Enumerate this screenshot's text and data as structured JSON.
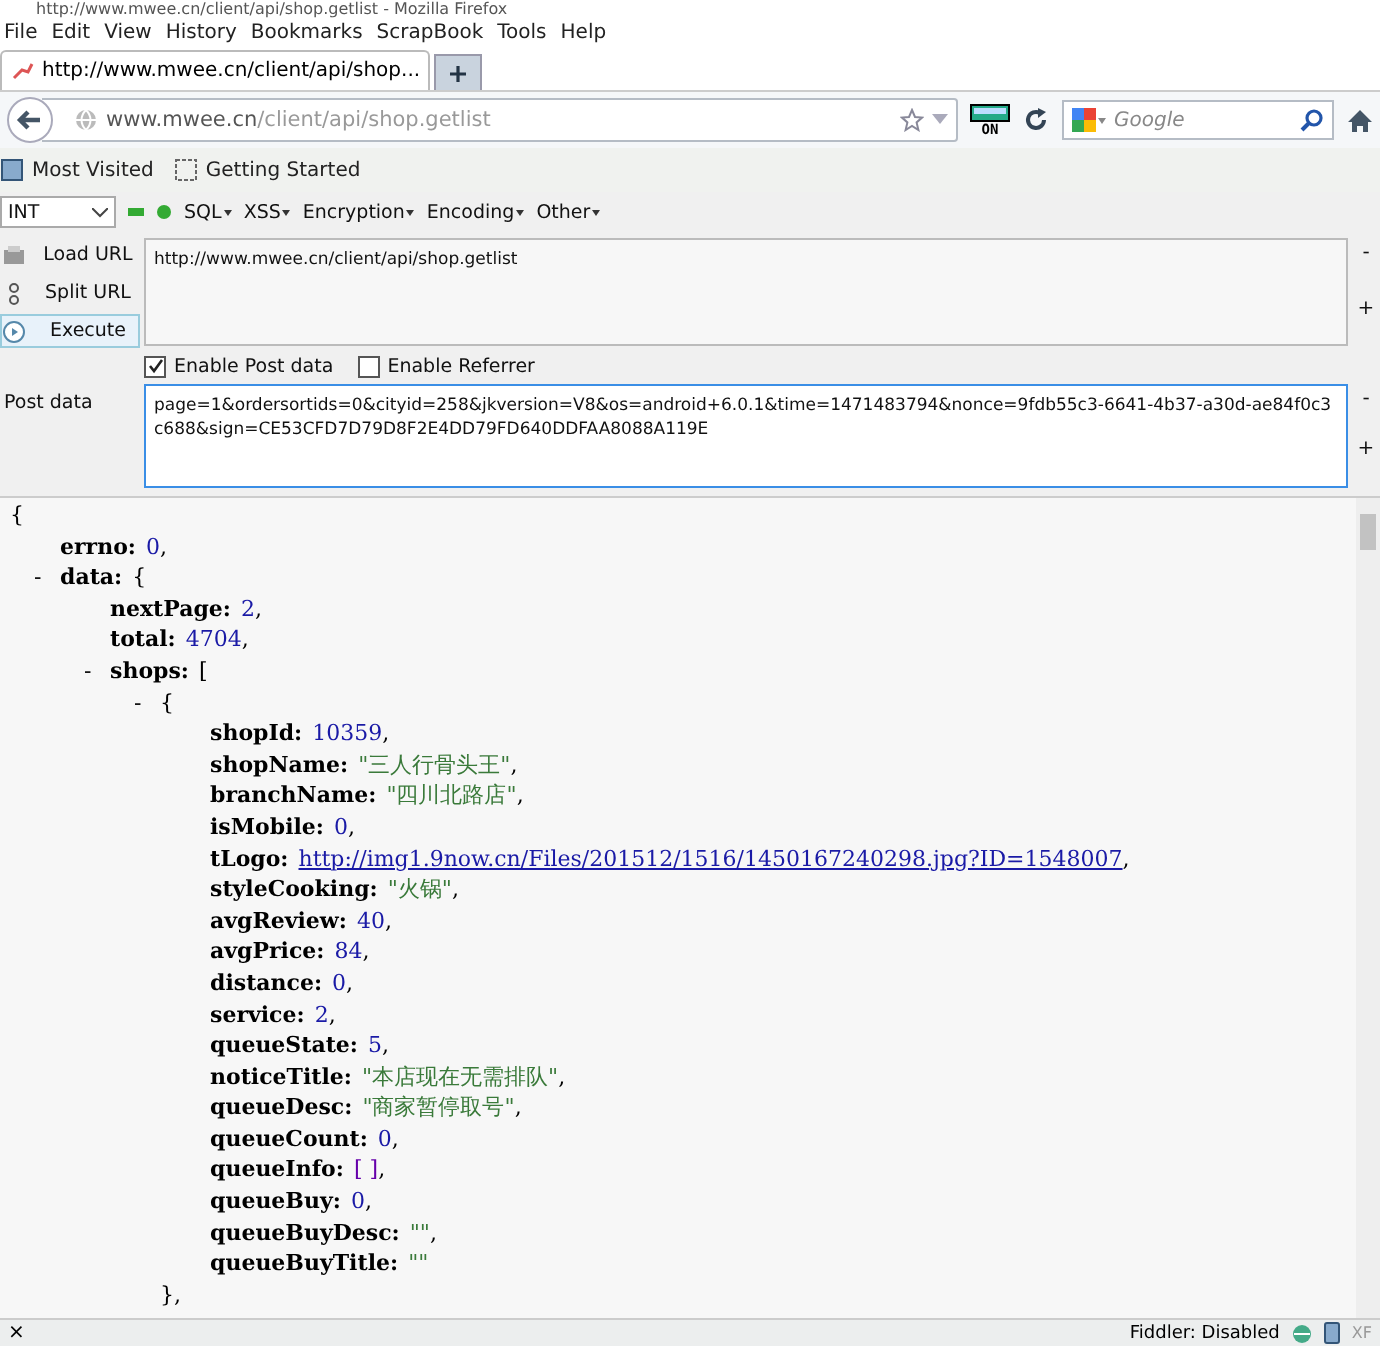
{
  "window": {
    "title": "http://www.mwee.cn/client/api/shop.getlist - Mozilla Firefox"
  },
  "menu": [
    "File",
    "Edit",
    "View",
    "History",
    "Bookmarks",
    "ScrapBook",
    "Tools",
    "Help"
  ],
  "tabs": [
    {
      "label": "http://www.mwee.cn/client/api/shop...",
      "selected": true
    }
  ],
  "address": {
    "domain": "www.mwee.cn",
    "path": "/client/api/shop.getlist"
  },
  "addon_badge": "ON",
  "search": {
    "placeholder": "Google"
  },
  "bookmarks": [
    {
      "label": "Most Visited",
      "kind": "folder"
    },
    {
      "label": "Getting Started",
      "kind": "page"
    }
  ],
  "hackbar": {
    "select": "INT",
    "menus": [
      "SQL",
      "XSS",
      "Encryption",
      "Encoding",
      "Other"
    ],
    "actions": [
      {
        "label": "Load URL",
        "kind": "load",
        "hovered": false
      },
      {
        "label": "Split URL",
        "kind": "split",
        "hovered": false
      },
      {
        "label": "Execute",
        "kind": "execute",
        "hovered": true
      }
    ],
    "url": "http://www.mwee.cn/client/api/shop.getlist",
    "options": [
      {
        "label": "Enable Post data",
        "checked": true
      },
      {
        "label": "Enable Referrer",
        "checked": false
      }
    ],
    "post_label": "Post data",
    "post_data": "page=1&ordersortids=0&cityid=258&jkversion=V8&os=android+6.0.1&time=1471483794&nonce=9fdb55c3-6641-4b37-a30d-ae84f0c3c688&sign=CE53CFD7D79D8F2E4DD79FD640DDFAA8088A119E",
    "side_minus": "-",
    "side_plus": "+"
  },
  "json_view": {
    "open": "{",
    "children": [
      {
        "key": "errno:",
        "value": "0",
        "kind": "number",
        "punct": ","
      },
      {
        "toggle": "-",
        "key": "data:",
        "open": "{",
        "children": [
          {
            "key": "nextPage:",
            "value": "2",
            "kind": "number",
            "punct": ","
          },
          {
            "key": "total:",
            "value": "4704",
            "kind": "number",
            "punct": ","
          },
          {
            "toggle": "-",
            "key": "shops:",
            "open": "[",
            "children": [
              {
                "toggle": "-",
                "open": "{",
                "close": "},",
                "children": [
                  {
                    "key": "shopId:",
                    "value": "10359",
                    "kind": "number",
                    "punct": ","
                  },
                  {
                    "key": "shopName:",
                    "value": "\"三人行骨头王\"",
                    "kind": "string",
                    "punct": ","
                  },
                  {
                    "key": "branchName:",
                    "value": "\"四川北路店\"",
                    "kind": "string",
                    "punct": ","
                  },
                  {
                    "key": "isMobile:",
                    "value": "0",
                    "kind": "number",
                    "punct": ","
                  },
                  {
                    "key": "tLogo:",
                    "value": "http://img1.9now.cn/Files/201512/1516/1450167240298.jpg?ID=1548007",
                    "kind": "link",
                    "punct": ","
                  },
                  {
                    "key": "styleCooking:",
                    "value": "\"火锅\"",
                    "kind": "string",
                    "punct": ","
                  },
                  {
                    "key": "avgReview:",
                    "value": "40",
                    "kind": "number",
                    "punct": ","
                  },
                  {
                    "key": "avgPrice:",
                    "value": "84",
                    "kind": "number",
                    "punct": ","
                  },
                  {
                    "key": "distance:",
                    "value": "0",
                    "kind": "number",
                    "punct": ","
                  },
                  {
                    "key": "service:",
                    "value": "2",
                    "kind": "number",
                    "punct": ","
                  },
                  {
                    "key": "queueState:",
                    "value": "5",
                    "kind": "number",
                    "punct": ","
                  },
                  {
                    "key": "noticeTitle:",
                    "value": "\"本店现在无需排队\"",
                    "kind": "string",
                    "punct": ","
                  },
                  {
                    "key": "queueDesc:",
                    "value": "\"商家暂停取号\"",
                    "kind": "string",
                    "punct": ","
                  },
                  {
                    "key": "queueCount:",
                    "value": "0",
                    "kind": "number",
                    "punct": ","
                  },
                  {
                    "key": "queueInfo:",
                    "value": "[ ]",
                    "kind": "array",
                    "punct": ","
                  },
                  {
                    "key": "queueBuy:",
                    "value": "0",
                    "kind": "number",
                    "punct": ","
                  },
                  {
                    "key": "queueBuyDesc:",
                    "value": "\"\"",
                    "kind": "string",
                    "punct": ","
                  },
                  {
                    "key": "queueBuyTitle:",
                    "value": "\"\"",
                    "kind": "string"
                  }
                ]
              }
            ]
          }
        ]
      }
    ]
  },
  "status_bar": {
    "close": "×",
    "fiddler": "Fiddler: Disabled",
    "badge": "XF"
  }
}
